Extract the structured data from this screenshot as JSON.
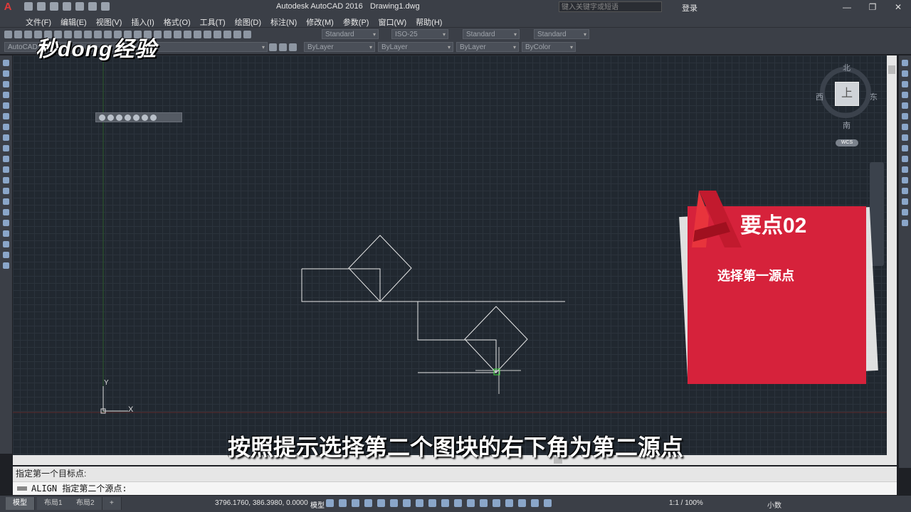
{
  "title_bar": {
    "app_title": "Autodesk AutoCAD 2016",
    "file_name": "Drawing1.dwg",
    "search_placeholder": "键入关键字或短语",
    "login_label": "登录",
    "minimize": "—",
    "restore": "❐",
    "close": "✕"
  },
  "menu": [
    "文件(F)",
    "编辑(E)",
    "视图(V)",
    "插入(I)",
    "格式(O)",
    "工具(T)",
    "绘图(D)",
    "标注(N)",
    "修改(M)",
    "参数(P)",
    "窗口(W)",
    "帮助(H)"
  ],
  "toolbar": {
    "text_style": "Standard",
    "dim_style": "ISO-25",
    "table_style": "Standard",
    "multileader_style": "Standard",
    "workspace": "AutoCAD",
    "layer_color": "ByLayer",
    "linetype": "ByLayer",
    "lineweight": "ByLayer",
    "plot_style": "ByColor"
  },
  "watermark": "秒dong经验",
  "viewcube": {
    "north": "北",
    "south": "南",
    "west": "西",
    "east": "东",
    "face": "上",
    "wcs": "WCS"
  },
  "ucs": {
    "x": "X",
    "y": "Y"
  },
  "card": {
    "title": "要点02",
    "subtitle": "选择第一源点"
  },
  "subtitle": "按照提示选择第二个图块的右下角为第二源点",
  "command": {
    "history": "指定第一个目标点:",
    "prompt": "ALIGN 指定第二个源点:"
  },
  "status": {
    "tabs": [
      "模型",
      "布局1",
      "布局2"
    ],
    "add_tab": "+",
    "coordinates": "3796.1760, 386.3980, 0.0000",
    "model_label": "模型",
    "scale": "1:1 / 100%",
    "units": "小数"
  },
  "colors": {
    "canvas": "#212830",
    "card_red": "#d6223b",
    "accent_red": "#e03a3a"
  }
}
